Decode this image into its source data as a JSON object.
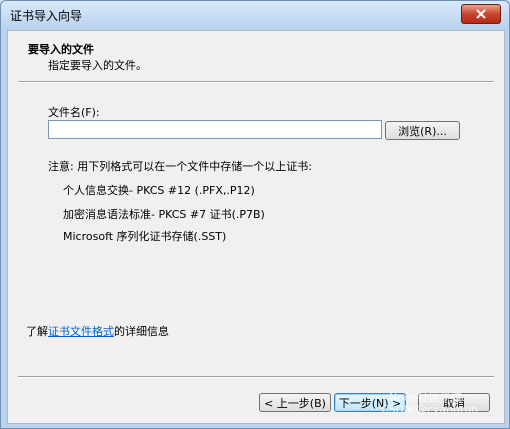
{
  "window": {
    "title": "证书导入向导"
  },
  "header": {
    "title": "要导入的文件",
    "subtitle": "指定要导入的文件。"
  },
  "file": {
    "label": "文件名(F):",
    "value": "",
    "browse_label": "浏览(R)..."
  },
  "note": {
    "heading": "注意: 用下列格式可以在一个文件中存储一个以上证书:",
    "formats": [
      "个人信息交换- PKCS #12 (.PFX,.P12)",
      "加密消息语法标准- PKCS #7 证书(.P7B)",
      "Microsoft 序列化证书存储(.SST)"
    ]
  },
  "info": {
    "prefix": "了解",
    "link": "证书文件格式",
    "suffix": "的详细信息"
  },
  "buttons": {
    "back": "< 上一步(B)",
    "next": "下一步(N) >",
    "cancel": "取消"
  },
  "watermark": {
    "line1": "Node社区学院",
    "line2": "CSDN @cyangron"
  }
}
